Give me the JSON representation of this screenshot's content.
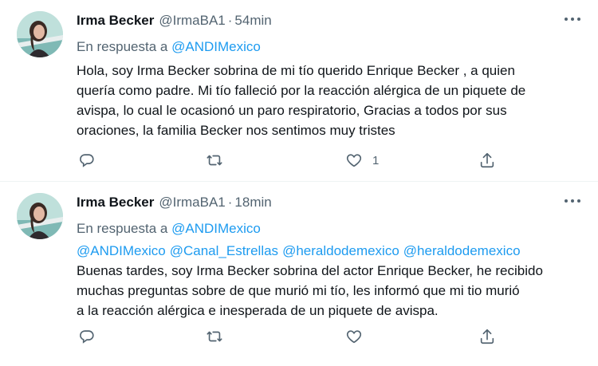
{
  "tweets": [
    {
      "name": "Irma Becker",
      "handle": "@IrmaBA1",
      "dot": "·",
      "time": "54min",
      "reply_prefix": "En respuesta a",
      "reply_handle": "@ANDIMexico",
      "mentions": [],
      "text": "Hola, soy Irma Becker sobrina de mi tío querido Enrique Becker , a quien\nquería como padre. Mi tío falleció por la reacción alérgica de un piquete de\navispa, lo cual le ocasionó un paro respiratorio, Gracias a todos por sus\noraciones, la familia Becker nos sentimos muy tristes",
      "like_count": "1",
      "icons": {
        "reply": "reply-icon",
        "retweet": "retweet-icon",
        "like": "heart-icon",
        "share": "share-icon",
        "more": "more-icon"
      }
    },
    {
      "name": "Irma Becker",
      "handle": "@IrmaBA1",
      "dot": "·",
      "time": "18min",
      "reply_prefix": "En respuesta a",
      "reply_handle": "@ANDIMexico",
      "mentions": [
        "@ANDIMexico",
        "@Canal_Estrellas",
        "@heraldodemexico",
        "@heraldodemexico"
      ],
      "text": "Buenas tardes, soy Irma Becker sobrina del actor Enrique Becker, he recibido\nmuchas preguntas sobre de que murió mi tío, les informó que mi tio murió\na la reacción alérgica e inesperada de un piquete de avispa.",
      "like_count": "",
      "icons": {
        "reply": "reply-icon",
        "retweet": "retweet-icon",
        "like": "heart-icon",
        "share": "share-icon",
        "more": "more-icon"
      }
    }
  ],
  "colors": {
    "link": "#1d9bf0",
    "muted": "#536471",
    "text": "#0f1419"
  }
}
